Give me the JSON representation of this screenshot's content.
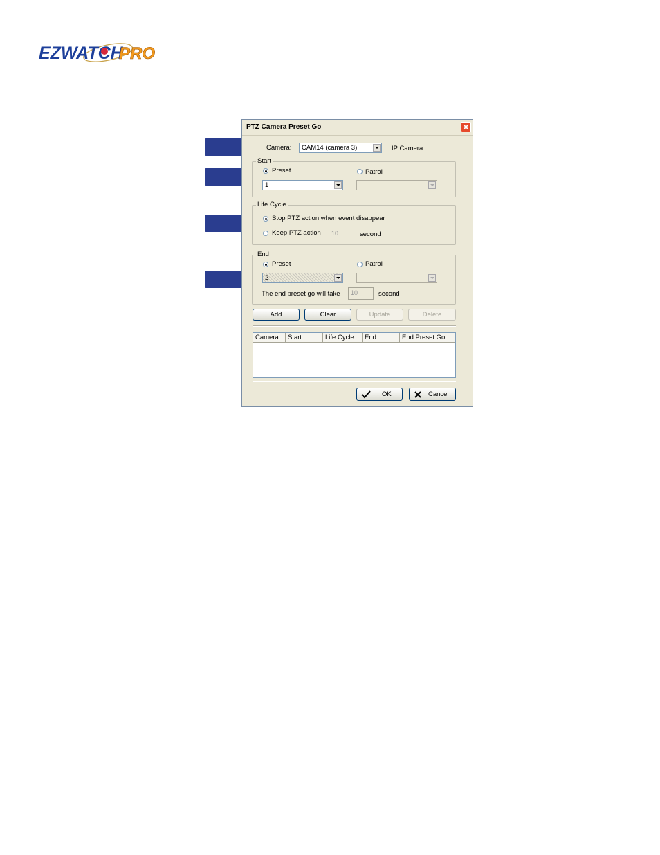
{
  "logo": {
    "text_main": "EZWATCH",
    "text_pro": "PRO"
  },
  "dialog": {
    "title": "PTZ Camera Preset Go",
    "camera": {
      "label": "Camera:",
      "value": "CAM14 (camera 3)",
      "type": "IP Camera"
    },
    "start": {
      "legend": "Start",
      "preset_label": "Preset",
      "patrol_label": "Patrol",
      "preset_value": "1",
      "selected": "preset"
    },
    "life_cycle": {
      "legend": "Life Cycle",
      "option_stop": "Stop PTZ action when event disappear",
      "option_keep": "Keep PTZ action",
      "keep_value": "10",
      "unit": "second",
      "selected": "stop"
    },
    "end": {
      "legend": "End",
      "preset_label": "Preset",
      "patrol_label": "Patrol",
      "preset_value": "2",
      "take_label": "The end preset go will take",
      "take_value": "10",
      "unit": "second",
      "selected": "preset"
    },
    "buttons": {
      "add": "Add",
      "clear": "Clear",
      "update": "Update",
      "delete": "Delete"
    },
    "table": {
      "columns": [
        "Camera",
        "Start",
        "Life Cycle",
        "End",
        "End Preset Go"
      ],
      "rows": []
    },
    "ok": "OK",
    "cancel": "Cancel"
  },
  "colors": {
    "pointer": "#2a3d8f",
    "titlebar_close": "#e64a2c",
    "logo_blue": "#1d3f9a",
    "logo_orange": "#f39a1e"
  }
}
